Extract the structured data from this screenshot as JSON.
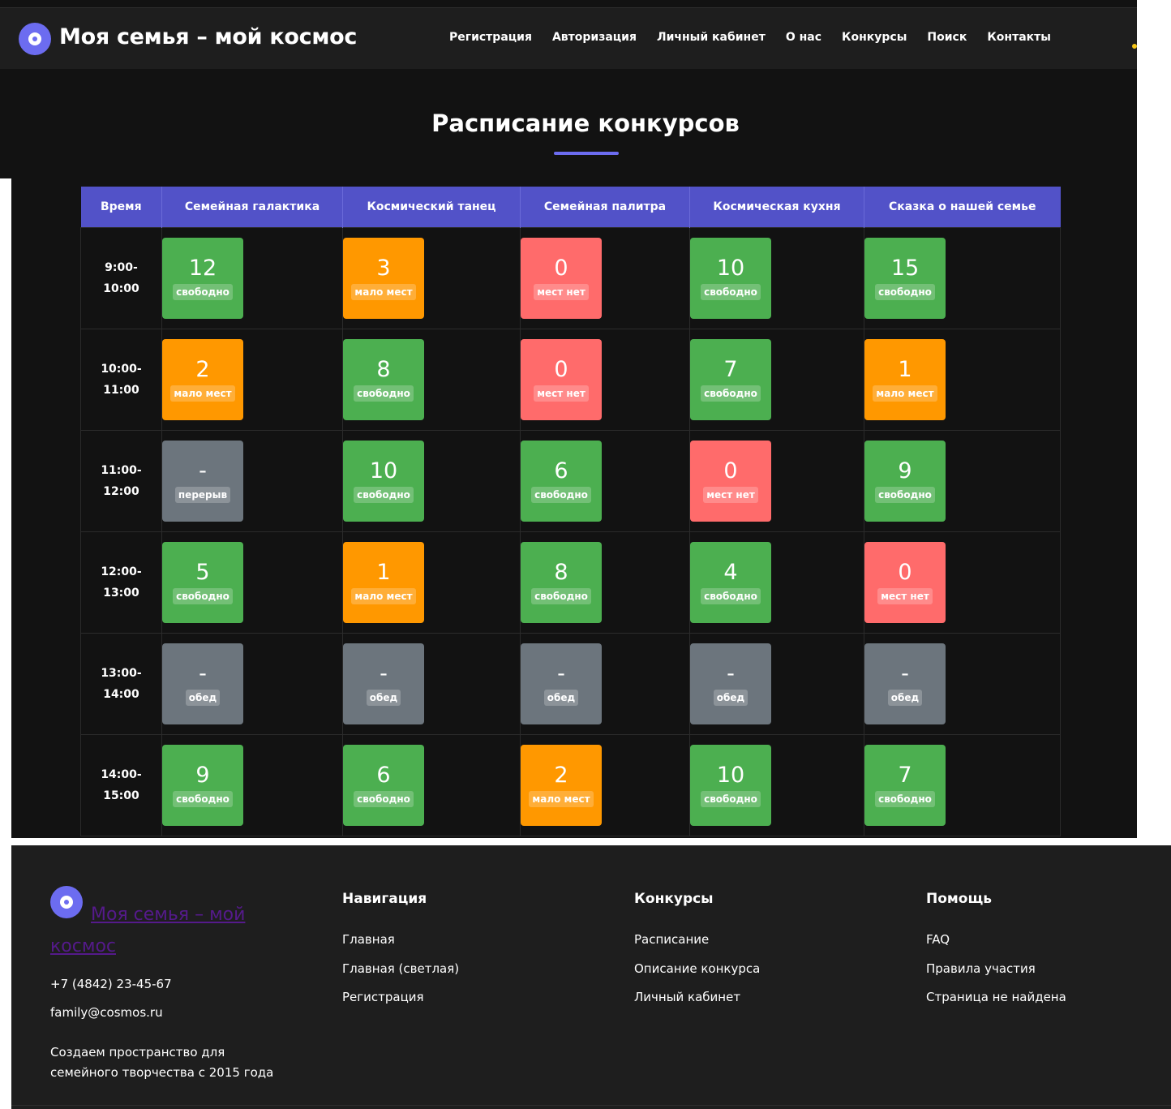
{
  "header": {
    "brand": "Моя семья – мой космос",
    "nav": [
      "Регистрация",
      "Авторизация",
      "Личный кабинет",
      "О нас",
      "Конкурсы",
      "Поиск",
      "Контакты"
    ]
  },
  "page_title": "Расписание конкурсов",
  "schedule": {
    "columns": [
      "Время",
      "Семейная галактика",
      "Космический танец",
      "Семейная палитра",
      "Космическая кухня",
      "Сказка о нашей семье"
    ],
    "rows": [
      {
        "time_start": "9:00-",
        "time_end": "10:00",
        "slots": [
          {
            "value": "12",
            "label": "свободно",
            "status": "green"
          },
          {
            "value": "3",
            "label": "мало мест",
            "status": "orange"
          },
          {
            "value": "0",
            "label": "мест нет",
            "status": "red"
          },
          {
            "value": "10",
            "label": "свободно",
            "status": "green"
          },
          {
            "value": "15",
            "label": "свободно",
            "status": "green"
          }
        ]
      },
      {
        "time_start": "10:00-",
        "time_end": "11:00",
        "slots": [
          {
            "value": "2",
            "label": "мало мест",
            "status": "orange"
          },
          {
            "value": "8",
            "label": "свободно",
            "status": "green"
          },
          {
            "value": "0",
            "label": "мест нет",
            "status": "red"
          },
          {
            "value": "7",
            "label": "свободно",
            "status": "green"
          },
          {
            "value": "1",
            "label": "мало мест",
            "status": "orange"
          }
        ]
      },
      {
        "time_start": "11:00-",
        "time_end": "12:00",
        "slots": [
          {
            "value": "-",
            "label": "перерыв",
            "status": "gray"
          },
          {
            "value": "10",
            "label": "свободно",
            "status": "green"
          },
          {
            "value": "6",
            "label": "свободно",
            "status": "green"
          },
          {
            "value": "0",
            "label": "мест нет",
            "status": "red"
          },
          {
            "value": "9",
            "label": "свободно",
            "status": "green"
          }
        ]
      },
      {
        "time_start": "12:00-",
        "time_end": "13:00",
        "slots": [
          {
            "value": "5",
            "label": "свободно",
            "status": "green"
          },
          {
            "value": "1",
            "label": "мало мест",
            "status": "orange"
          },
          {
            "value": "8",
            "label": "свободно",
            "status": "green"
          },
          {
            "value": "4",
            "label": "свободно",
            "status": "green"
          },
          {
            "value": "0",
            "label": "мест нет",
            "status": "red"
          }
        ]
      },
      {
        "time_start": "13:00-",
        "time_end": "14:00",
        "slots": [
          {
            "value": "-",
            "label": "обед",
            "status": "gray"
          },
          {
            "value": "-",
            "label": "обед",
            "status": "gray"
          },
          {
            "value": "-",
            "label": "обед",
            "status": "gray"
          },
          {
            "value": "-",
            "label": "обед",
            "status": "gray"
          },
          {
            "value": "-",
            "label": "обед",
            "status": "gray"
          }
        ]
      },
      {
        "time_start": "14:00-",
        "time_end": "15:00",
        "slots": [
          {
            "value": "9",
            "label": "свободно",
            "status": "green"
          },
          {
            "value": "6",
            "label": "свободно",
            "status": "green"
          },
          {
            "value": "2",
            "label": "мало мест",
            "status": "orange"
          },
          {
            "value": "10",
            "label": "свободно",
            "status": "green"
          },
          {
            "value": "7",
            "label": "свободно",
            "status": "green"
          }
        ]
      }
    ]
  },
  "footer": {
    "brand": "Моя семья – мой космос",
    "phone": "+7 (4842) 23-45-67",
    "email": "family@cosmos.ru",
    "about": "Создаем пространство для семейного творчества с 2015 года",
    "columns": [
      {
        "title": "Навигация",
        "links": [
          "Главная",
          "Главная (светлая)",
          "Регистрация"
        ]
      },
      {
        "title": "Конкурсы",
        "links": [
          "Расписание",
          "Описание конкурса",
          "Личный кабинет"
        ]
      },
      {
        "title": "Помощь",
        "links": [
          "FAQ",
          "Правила участия",
          "Страница не найдена"
        ]
      }
    ]
  },
  "colors": {
    "accent": "#6c6cf0",
    "table_header": "#5252c8",
    "status_green": "#4caf50",
    "status_orange": "#ff9800",
    "status_red": "#ff6b6b",
    "status_gray": "#6c757d",
    "footer_link_visited": "#551a8b"
  },
  "icons": [
    "logo-icon",
    "moon-icon"
  ]
}
